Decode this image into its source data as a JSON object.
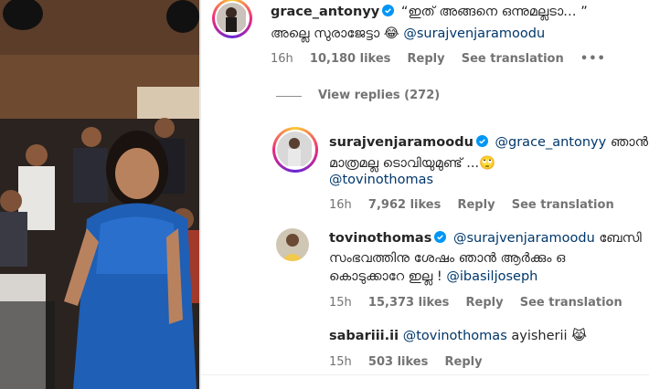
{
  "comments": [
    {
      "username": "grace_antonyy",
      "verified": true,
      "text_line1": "“ഇത് അങ്ങനെ ഒന്നുമല്ലടാ… ”",
      "text_line2": "അല്ലെ സുരാജേട്ടാ 😂",
      "mention": "@surajvenjaramoodu",
      "time": "16h",
      "likes": "10,180 likes",
      "reply": "Reply",
      "translate": "See translation",
      "more": "•••",
      "view_replies": "View replies (272)"
    },
    {
      "username": "surajvenjaramoodu",
      "verified": true,
      "mention_inline": "@grace_antonyy",
      "text_tail": "ഞാൻ",
      "text_line2": "മാത്രമല്ല ടൊവിയുമുണ്ട് ...🙄",
      "mention_line3": "@tovinothomas",
      "time": "16h",
      "likes": "7,962 likes",
      "reply": "Reply",
      "translate": "See translation"
    },
    {
      "username": "tovinothomas",
      "verified": true,
      "mention_inline": "@surajvenjaramoodu",
      "text_tail": "ബേസി",
      "text_line2": "സംഭവത്തിനു ശേഷം ഞാൻ ആർക്കും ഒ",
      "text_line3": "കൊടുക്കാറേ ഇല്ല !",
      "mention_line3": "@ibasiljoseph",
      "time": "15h",
      "likes": "15,373 likes",
      "reply": "Reply",
      "translate": "See translation"
    },
    {
      "username": "sabariii.ii",
      "verified": false,
      "mention_inline": "@tovinothomas",
      "text_tail": "ayisherii 😹",
      "time": "15h",
      "likes": "503 likes",
      "reply": "Reply"
    }
  ],
  "colors": {
    "mention": "#00376b",
    "meta": "#737373",
    "verified": "#0095f6"
  }
}
